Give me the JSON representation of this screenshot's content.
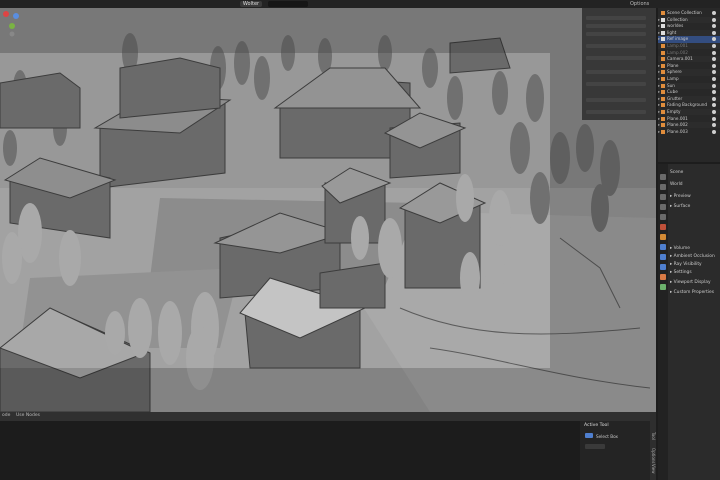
{
  "topbar": {
    "workspace_tab": "Wolter",
    "options_label": "Options"
  },
  "timeline": {
    "left_label": "ode",
    "mode_label": "Use Nodes"
  },
  "outliner": {
    "items": [
      {
        "label": "Scene Collection",
        "color": "#d0d0d0",
        "expand": ""
      },
      {
        "label": "Collection",
        "color": "#c9c9c9",
        "expand": "▸"
      },
      {
        "label": "worldes",
        "color": "#c9c9c9",
        "expand": "▸"
      },
      {
        "label": "light",
        "color": "#c9c9c9",
        "expand": "▸"
      },
      {
        "label": "Ref image",
        "color": "#c9c9c9",
        "expand": "▸"
      },
      {
        "label": "Lamp.001",
        "color": "#777777",
        "expand": ""
      },
      {
        "label": "Lamp.002",
        "color": "#777777",
        "expand": ""
      },
      {
        "label": "Camera.001",
        "color": "#c9c9c9",
        "expand": ""
      },
      {
        "label": "Plane",
        "color": "#c9c9c9",
        "expand": "▸"
      },
      {
        "label": "Sphere",
        "color": "#c9c9c9",
        "expand": "▸"
      },
      {
        "label": "Lamp",
        "color": "#c9c9c9",
        "expand": "▸"
      },
      {
        "label": "Sun",
        "color": "#c9c9c9",
        "expand": "▸"
      },
      {
        "label": "Cube",
        "color": "#c9c9c9",
        "expand": "▸"
      },
      {
        "label": "Grutter",
        "color": "#c9c9c9",
        "expand": "▸"
      },
      {
        "label": "Fading Background",
        "color": "#c9c9c9",
        "expand": "▸"
      },
      {
        "label": "Empty",
        "color": "#c9c9c9",
        "expand": "▸"
      },
      {
        "label": "Plane.001",
        "color": "#c9c9c9",
        "expand": "▸"
      },
      {
        "label": "Plane.002",
        "color": "#c9c9c9",
        "expand": "▸"
      },
      {
        "label": "Plane.003",
        "color": "#c9c9c9",
        "expand": "▸"
      }
    ]
  },
  "properties": {
    "scene_label": "Scene",
    "world_label": "World",
    "sections": [
      "Preview",
      "Surface",
      "Volume",
      "Ambient Occlusion",
      "Ray Visibility",
      "Settings",
      "Viewport Display",
      "Custom Properties"
    ]
  },
  "active_tool": {
    "title": "Active Tool",
    "tool_name": "Select Box"
  },
  "side_tabs": [
    "Tool",
    "Options",
    "View"
  ],
  "colors": {
    "accent": "#334d80",
    "viewport_bg": "#8d8d8d",
    "outliner_icon_orange": "#e08d3c"
  }
}
